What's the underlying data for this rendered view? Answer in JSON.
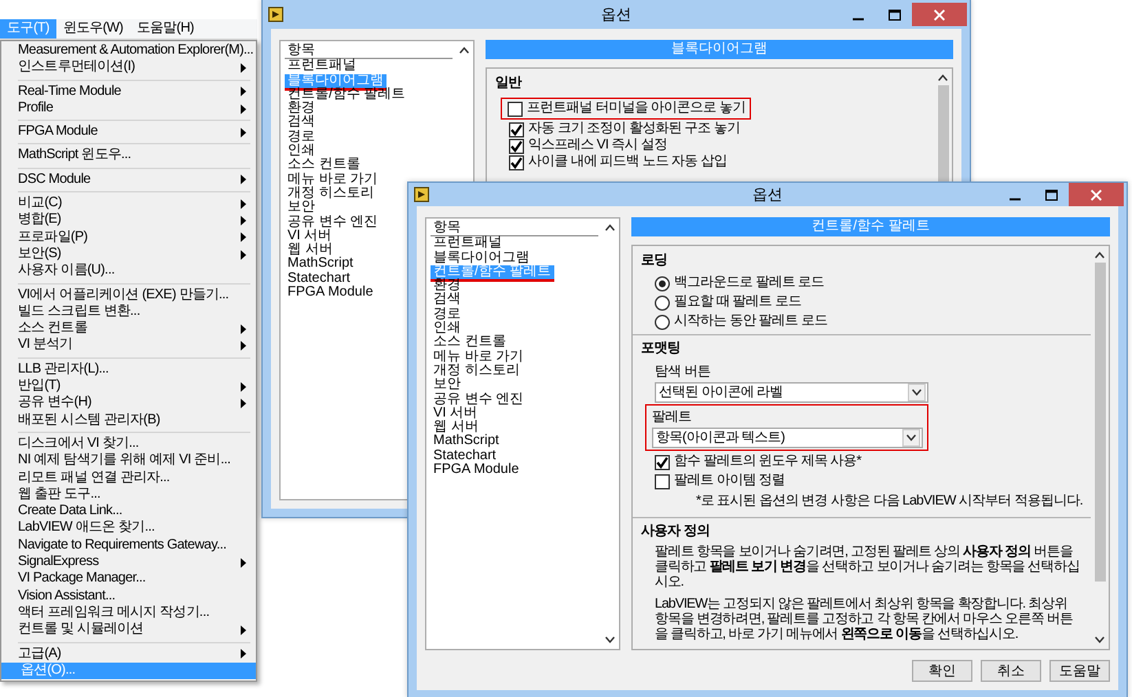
{
  "menu": {
    "menubar": [
      {
        "label": "도구(T)",
        "selected": true
      },
      {
        "label": "윈도우(W)",
        "selected": false
      },
      {
        "label": "도움말(H)",
        "selected": false
      }
    ],
    "items": [
      {
        "kind": "item",
        "label": "Measurement & Automation Explorer(M)...",
        "submenu": false,
        "selected": false
      },
      {
        "kind": "item",
        "label": "인스트루먼테이션(I)",
        "submenu": true,
        "selected": false
      },
      {
        "kind": "separator"
      },
      {
        "kind": "item",
        "label": "Real-Time Module",
        "submenu": true,
        "selected": false
      },
      {
        "kind": "item",
        "label": "Profile",
        "submenu": true,
        "selected": false
      },
      {
        "kind": "separator"
      },
      {
        "kind": "item",
        "label": "FPGA Module",
        "submenu": true,
        "selected": false
      },
      {
        "kind": "separator"
      },
      {
        "kind": "item",
        "label": "MathScript 윈도우...",
        "submenu": false,
        "selected": false
      },
      {
        "kind": "separator"
      },
      {
        "kind": "item",
        "label": "DSC Module",
        "submenu": true,
        "selected": false
      },
      {
        "kind": "separator"
      },
      {
        "kind": "item",
        "label": "비교(C)",
        "submenu": true,
        "selected": false
      },
      {
        "kind": "item",
        "label": "병합(E)",
        "submenu": true,
        "selected": false
      },
      {
        "kind": "item",
        "label": "프로파일(P)",
        "submenu": true,
        "selected": false
      },
      {
        "kind": "item",
        "label": "보안(S)",
        "submenu": true,
        "selected": false
      },
      {
        "kind": "item",
        "label": "사용자 이름(U)...",
        "submenu": false,
        "selected": false
      },
      {
        "kind": "separator"
      },
      {
        "kind": "item",
        "label": "VI에서 어플리케이션 (EXE) 만들기...",
        "submenu": false,
        "selected": false
      },
      {
        "kind": "item",
        "label": "빌드 스크립트 변환...",
        "submenu": false,
        "selected": false
      },
      {
        "kind": "item",
        "label": "소스 컨트롤",
        "submenu": true,
        "selected": false
      },
      {
        "kind": "item",
        "label": "VI 분석기",
        "submenu": true,
        "selected": false
      },
      {
        "kind": "separator"
      },
      {
        "kind": "item",
        "label": "LLB 관리자(L)...",
        "submenu": false,
        "selected": false
      },
      {
        "kind": "item",
        "label": "반입(T)",
        "submenu": true,
        "selected": false
      },
      {
        "kind": "item",
        "label": "공유 변수(H)",
        "submenu": true,
        "selected": false
      },
      {
        "kind": "item",
        "label": "배포된 시스템 관리자(B)",
        "submenu": false,
        "selected": false
      },
      {
        "kind": "separator"
      },
      {
        "kind": "item",
        "label": "디스크에서 VI 찾기...",
        "submenu": false,
        "selected": false
      },
      {
        "kind": "item",
        "label": "NI 예제 탐색기를 위해 예제 VI 준비...",
        "submenu": false,
        "selected": false
      },
      {
        "kind": "item",
        "label": "리모트 패널 연결 관리자...",
        "submenu": false,
        "selected": false
      },
      {
        "kind": "item",
        "label": "웹 출판 도구...",
        "submenu": false,
        "selected": false
      },
      {
        "kind": "item",
        "label": "Create Data Link...",
        "submenu": false,
        "selected": false
      },
      {
        "kind": "item",
        "label": "LabVIEW 애드온 찾기...",
        "submenu": false,
        "selected": false
      },
      {
        "kind": "item",
        "label": "Navigate to Requirements Gateway...",
        "submenu": false,
        "selected": false
      },
      {
        "kind": "item",
        "label": "SignalExpress",
        "submenu": true,
        "selected": false
      },
      {
        "kind": "item",
        "label": "VI Package Manager...",
        "submenu": false,
        "selected": false
      },
      {
        "kind": "item",
        "label": "Vision Assistant...",
        "submenu": false,
        "selected": false
      },
      {
        "kind": "item",
        "label": "액터 프레임워크 메시지 작성기...",
        "submenu": false,
        "selected": false
      },
      {
        "kind": "item",
        "label": "컨트롤 및 시뮬레이션",
        "submenu": true,
        "selected": false
      },
      {
        "kind": "separator"
      },
      {
        "kind": "item",
        "label": "고급(A)",
        "submenu": true,
        "selected": false
      },
      {
        "kind": "item",
        "label": "옵션(O)...",
        "submenu": false,
        "selected": true
      }
    ]
  },
  "windows": [
    {
      "title": "옵션",
      "categories": [
        {
          "label": "항목",
          "selected": false
        },
        {
          "label": "프런트패널",
          "selected": false
        },
        {
          "label": "블록다이어그램",
          "selected": true
        },
        {
          "label": "컨트롤/함수 팔레트",
          "selected": false
        },
        {
          "label": "환경",
          "selected": false
        },
        {
          "label": "검색",
          "selected": false
        },
        {
          "label": "경로",
          "selected": false
        },
        {
          "label": "인쇄",
          "selected": false
        },
        {
          "label": "소스 컨트롤",
          "selected": false
        },
        {
          "label": "메뉴 바로 가기",
          "selected": false
        },
        {
          "label": "개정 히스토리",
          "selected": false
        },
        {
          "label": "보안",
          "selected": false
        },
        {
          "label": "공유 변수 엔진",
          "selected": false
        },
        {
          "label": "VI 서버",
          "selected": false
        },
        {
          "label": "웹 서버",
          "selected": false
        },
        {
          "label": "MathScript",
          "selected": false
        },
        {
          "label": "Statechart",
          "selected": false
        },
        {
          "label": "FPGA Module",
          "selected": false
        }
      ],
      "header": "블록다이어그램",
      "blocks": [
        {
          "kind": "heading",
          "label": "일반"
        },
        {
          "kind": "checkbox",
          "label": "프런트패널 터미널을 아이콘으로 놓기",
          "checked": false,
          "highlighted": true
        },
        {
          "kind": "checkbox",
          "label": "자동 크기 조정이 활성화된 구조 놓기",
          "checked": true,
          "highlighted": false
        },
        {
          "kind": "checkbox",
          "label": "익스프레스 VI 즉시 설정",
          "checked": true,
          "highlighted": false
        },
        {
          "kind": "checkbox",
          "label": "사이클 내에 피드백 노드 자동 삽입",
          "checked": true,
          "highlighted": false
        }
      ]
    },
    {
      "title": "옵션",
      "categories": [
        {
          "label": "항목",
          "selected": false
        },
        {
          "label": "프런트패널",
          "selected": false
        },
        {
          "label": "블록다이어그램",
          "selected": false
        },
        {
          "label": "컨트롤/함수 팔레트",
          "selected": true
        },
        {
          "label": "환경",
          "selected": false
        },
        {
          "label": "검색",
          "selected": false
        },
        {
          "label": "경로",
          "selected": false
        },
        {
          "label": "인쇄",
          "selected": false
        },
        {
          "label": "소스 컨트롤",
          "selected": false
        },
        {
          "label": "메뉴 바로 가기",
          "selected": false
        },
        {
          "label": "개정 히스토리",
          "selected": false
        },
        {
          "label": "보안",
          "selected": false
        },
        {
          "label": "공유 변수 엔진",
          "selected": false
        },
        {
          "label": "VI 서버",
          "selected": false
        },
        {
          "label": "웹 서버",
          "selected": false
        },
        {
          "label": "MathScript",
          "selected": false
        },
        {
          "label": "Statechart",
          "selected": false
        },
        {
          "label": "FPGA Module",
          "selected": false
        }
      ],
      "header": "컨트롤/함수 팔레트",
      "blocks": [
        {
          "kind": "heading",
          "label": "로딩"
        },
        {
          "kind": "radio",
          "label": "백그라운드로 팔레트 로드",
          "selected": true
        },
        {
          "kind": "radio",
          "label": "필요할 때 팔레트 로드",
          "selected": false
        },
        {
          "kind": "radio",
          "label": "시작하는 동안 팔레트 로드",
          "selected": false
        },
        {
          "kind": "divider"
        },
        {
          "kind": "heading",
          "label": "포맷팅"
        },
        {
          "kind": "dropdown",
          "label": "탐색 버튼",
          "value": "선택된 아이콘에 라벨",
          "highlighted": false
        },
        {
          "kind": "dropdown",
          "label": "팔레트",
          "value": "항목(아이콘과 텍스트)",
          "highlighted": true
        },
        {
          "kind": "checkbox",
          "label": "함수 팔레트의 윈도우 제목 사용*",
          "checked": true,
          "highlighted": false
        },
        {
          "kind": "checkbox",
          "label": "팔레트 아이템 정렬",
          "checked": false,
          "highlighted": false
        },
        {
          "kind": "note",
          "label": "*로 표시된 옵션의 변경 사항은 다음 LabVIEW 시작부터 적용됩니다."
        },
        {
          "kind": "divider"
        },
        {
          "kind": "heading",
          "label": "사용자 정의"
        },
        {
          "kind": "paragraph",
          "label": "팔레트 항목을 보이거나 숨기려면, 고정된 팔레트 상의 **사용자 정의** 버튼을 클릭하고 **팔레트 보기 변경**을 선택하고 보이거나 숨기려는 항목을 선택하십시오."
        },
        {
          "kind": "paragraph",
          "label": "LabVIEW는 고정되지 않은 팔레트에서 최상위 항목을 확장합니다. 최상위 항목을 변경하려면, 팔레트를 고정하고 각 항목 칸에서 마우스 오른쪽 버튼을 클릭하고, 바로 가기 메뉴에서 **왼쪽으로 이동**을 선택하십시오."
        }
      ],
      "buttons": [
        "확인",
        "취소",
        "도움말"
      ]
    }
  ]
}
